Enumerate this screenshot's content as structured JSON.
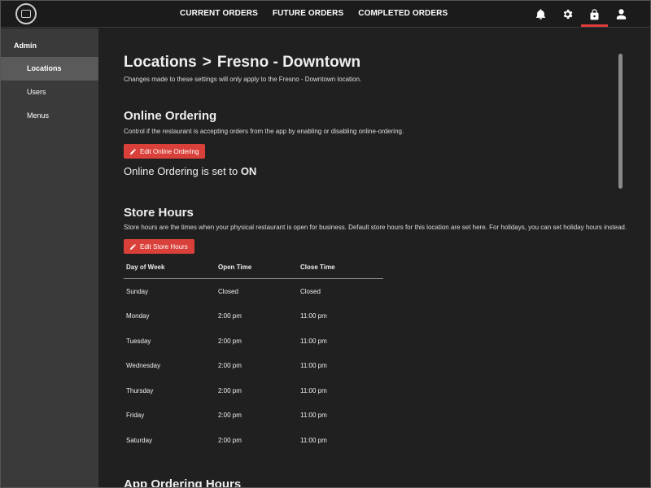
{
  "header": {
    "nav": [
      "CURRENT ORDERS",
      "FUTURE ORDERS",
      "COMPLETED ORDERS"
    ],
    "icons": [
      "bell-icon",
      "gear-icon",
      "lock-icon",
      "user-icon"
    ],
    "active_icon": "lock-icon",
    "accent_color": "#e03c3c"
  },
  "sidebar": {
    "title": "Admin",
    "items": [
      {
        "label": "Locations",
        "active": true
      },
      {
        "label": "Users",
        "active": false
      },
      {
        "label": "Menus",
        "active": false
      }
    ]
  },
  "page": {
    "breadcrumb_root": "Locations",
    "breadcrumb_separator": ">",
    "breadcrumb_current": "Fresno - Downtown",
    "description": "Changes made to these settings will only apply to the Fresno - Downtown location."
  },
  "online_ordering": {
    "title": "Online Ordering",
    "description": "Control if the restaurant is accepting orders from the app by enabling or disabling online-ordering.",
    "button_label": "Edit Online Ordering",
    "status_prefix": "Online Ordering is set to",
    "status_value": "ON"
  },
  "store_hours": {
    "title": "Store Hours",
    "description": "Store hours are the times when your physical restaurant is open for business. Default store hours for this location are set here. For holidays, you can set holiday hours instead.",
    "button_label": "Edit Store Hours",
    "columns": [
      "Day of Week",
      "Open Time",
      "Close Time"
    ],
    "rows": [
      [
        "Sunday",
        "Closed",
        "Closed"
      ],
      [
        "Monday",
        "2:00 pm",
        "11:00 pm"
      ],
      [
        "Tuesday",
        "2:00 pm",
        "11:00 pm"
      ],
      [
        "Wednesday",
        "2:00 pm",
        "11:00 pm"
      ],
      [
        "Thursday",
        "2:00 pm",
        "11:00 pm"
      ],
      [
        "Friday",
        "2:00 pm",
        "11:00 pm"
      ],
      [
        "Saturday",
        "2:00 pm",
        "11:00 pm"
      ]
    ]
  },
  "next_section_title": "App Ordering Hours"
}
